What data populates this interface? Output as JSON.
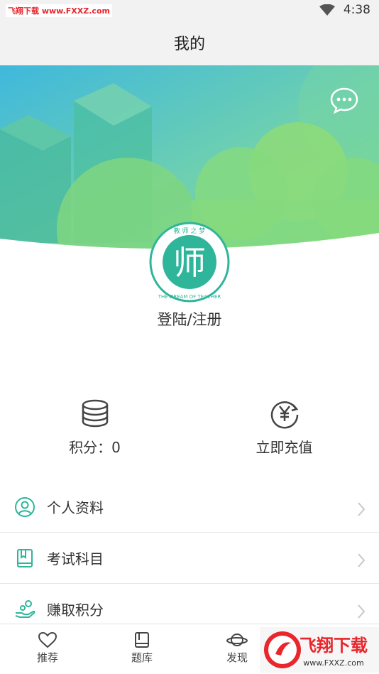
{
  "status_bar": {
    "watermark": "飞翔下载 www.FXXZ.com",
    "time": "4:38"
  },
  "header": {
    "title": "我的"
  },
  "profile": {
    "avatar_char": "师",
    "avatar_ring_top": "教 师 之 梦",
    "avatar_ring_bottom": "THE DREAM OF TEACHER",
    "login_label": "登陆/注册"
  },
  "stats": {
    "points_label": "积分：0",
    "recharge_label": "立即充值"
  },
  "menu": {
    "items": [
      {
        "label": "个人资料",
        "icon": "person-profile-icon"
      },
      {
        "label": "考试科目",
        "icon": "book-icon"
      },
      {
        "label": "赚取积分",
        "icon": "earn-coins-icon"
      }
    ]
  },
  "bottom_nav": {
    "items": [
      {
        "label": "推荐",
        "icon": "heart-icon"
      },
      {
        "label": "题库",
        "icon": "question-bank-icon"
      },
      {
        "label": "发现",
        "icon": "planet-icon"
      }
    ],
    "brand_text": "飞翔下载",
    "brand_url": "www.FXXZ.com"
  },
  "colors": {
    "accent": "#2fb59a",
    "brand_red": "#e8262c"
  }
}
